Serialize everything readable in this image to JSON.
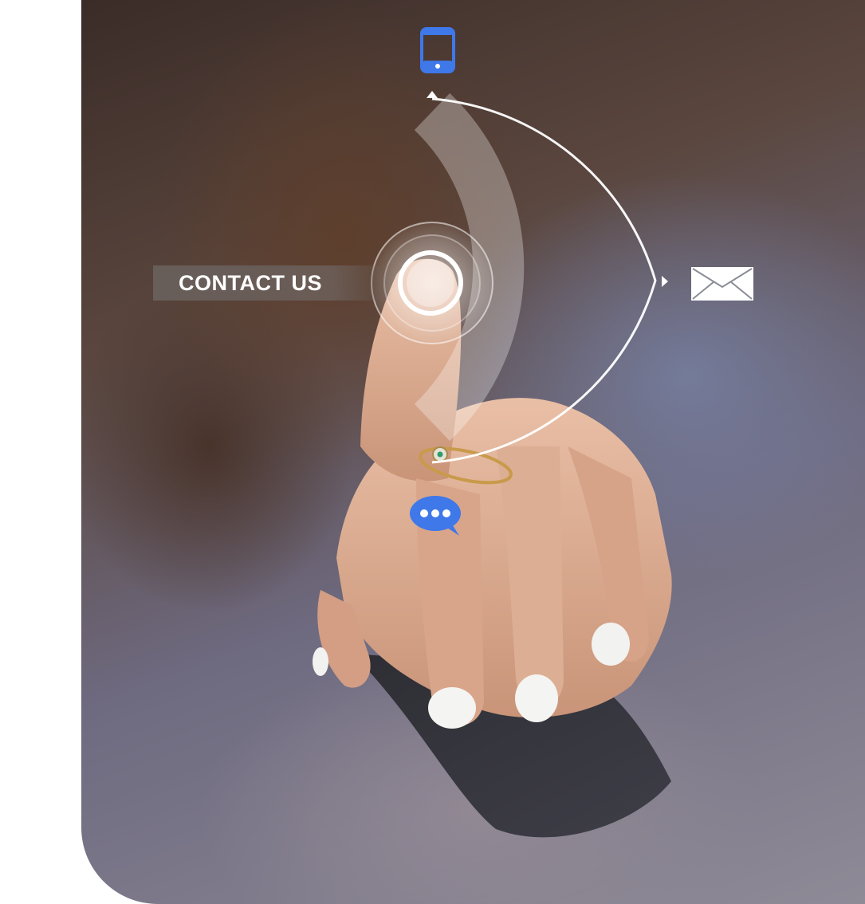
{
  "contact": {
    "label": "CONTACT US"
  },
  "icons": {
    "tablet": "tablet-icon",
    "mail": "envelope-icon",
    "chat": "chat-bubble-icon"
  },
  "colors": {
    "icon_blue": "#3f78e8",
    "label_background": "#6b625e",
    "overlay_white": "#ffffff",
    "page_background": "#ffffff"
  }
}
